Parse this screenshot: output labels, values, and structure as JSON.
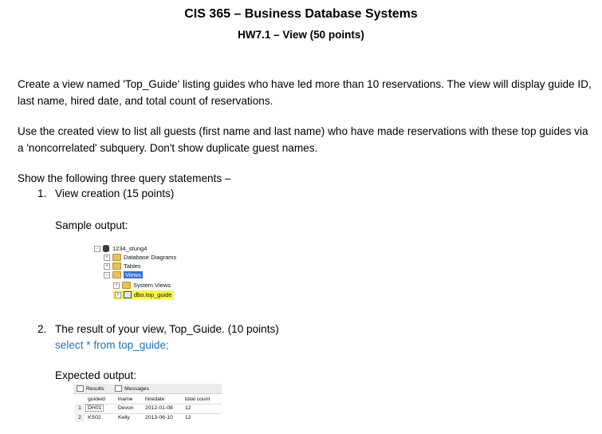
{
  "header": {
    "course_title": "CIS 365 – Business Database Systems",
    "assignment_title": "HW7.1 – View (50 points)"
  },
  "paragraphs": [
    "Create a view named 'Top_Guide' listing guides who have led more than 10 reservations. The view will display guide ID, last name, hired date, and total count of reservations.",
    "Use the created view to list all guests (first name and last name) who have made reservations with these top guides via a 'noncorrelated' subquery. Don't show duplicate guest names.",
    "Show the following three query statements –"
  ],
  "items": [
    {
      "number": "1.",
      "text": "View creation (15 points)"
    },
    {
      "number": "2.",
      "text": "The result of your view, Top_Guide. (10 points)"
    }
  ],
  "sample_label": "Sample output:",
  "sql_statement": "select * from top_guide;",
  "expected_label": "Expected output:",
  "object_explorer": {
    "database": "1234_stung4",
    "nodes": [
      "Database Diagrams",
      "Tables",
      "Views",
      "System Views",
      "dbo.top_guide"
    ],
    "expanders": {
      "collapsed": "+",
      "expanded": "−"
    }
  },
  "results_grid": {
    "tabs": [
      "Results",
      "Messages"
    ],
    "columns": [
      "guideid",
      "lname",
      "hiredate",
      "total count"
    ],
    "rows": [
      {
        "n": "1",
        "cells": [
          "DH01",
          "Devon",
          "2012-01-08",
          "12"
        ]
      },
      {
        "n": "2",
        "cells": [
          "KS02",
          "Kelly",
          "2013-06-10",
          "12"
        ]
      }
    ]
  }
}
